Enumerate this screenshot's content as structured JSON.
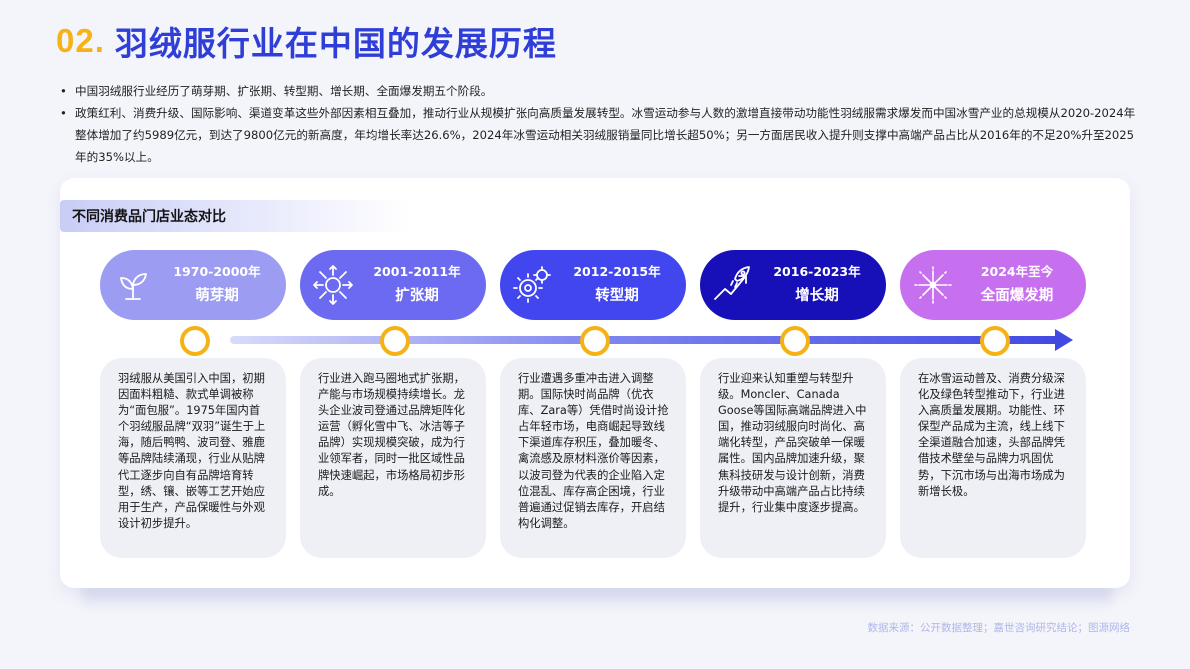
{
  "header": {
    "number": "02.",
    "title": "羽绒服行业在中国的发展历程"
  },
  "bullets": [
    "中国羽绒服行业经历了萌芽期、扩张期、转型期、增长期、全面爆发期五个阶段。",
    "政策红利、消费升级、国际影响、渠道变革这些外部因素相互叠加，推动行业从规模扩张向高质量发展转型。冰雪运动参与人数的激增直接带动功能性羽绒服需求爆发而中国冰雪产业的总规模从2020-2024年整体增加了约5989亿元，到达了9800亿元的新高度，年均增长率达26.6%，2024年冰雪运动相关羽绒服销量同比增长超50%；另一方面居民收入提升则支撑中高端产品占比从2016年的不足20%升至2025年的35%以上。"
  ],
  "card": {
    "subtitle": "不同消费品门店业态对比"
  },
  "timeline": [
    {
      "years": "1970-2000年",
      "stage": "萌芽期",
      "icon": "sprout-icon",
      "color": "#9c9cf2",
      "desc": "羽绒服从美国引入中国，初期因面料粗糙、款式单调被称为“面包服”。1975年国内首个羽绒服品牌“双羽”诞生于上海，随后鸭鸭、波司登、雅鹿等品牌陆续涌现，行业从贴牌代工逐步向自有品牌培育转型，绣、镶、嵌等工艺开始应用于生产，产品保暖性与外观设计初步提升。"
    },
    {
      "years": "2001-2011年",
      "stage": "扩张期",
      "icon": "expand-icon",
      "color": "#6b6af0",
      "desc": "行业进入跑马圈地式扩张期，产能与市场规模持续增长。龙头企业波司登通过品牌矩阵化运营（孵化雪中飞、冰洁等子品牌）实现规模突破，成为行业领军者，同时一批区域性品牌快速崛起，市场格局初步形成。"
    },
    {
      "years": "2012-2015年",
      "stage": "转型期",
      "icon": "gears-icon",
      "color": "#4146ef",
      "desc": "行业遭遇多重冲击进入调整期。国际快时尚品牌（优衣库、Zara等）凭借时尚设计抢占年轻市场，电商崛起导致线下渠道库存积压，叠加暖冬、禽流感及原材料涨价等因素，以波司登为代表的企业陷入定位混乱、库存高企困境，行业普遍通过促销去库存，开启结构化调整。"
    },
    {
      "years": "2016-2023年",
      "stage": "增长期",
      "icon": "rocket-growth-icon",
      "color": "#1710b8",
      "desc": "行业迎来认知重塑与转型升级。Moncler、Canada Goose等国际高端品牌进入中国，推动羽绒服向时尚化、高端化转型，产品突破单一保暖属性。国内品牌加速升级，聚焦科技研发与设计创新，消费升级带动中高端产品占比持续提升，行业集中度逐步提高。"
    },
    {
      "years": "2024年至今",
      "stage": "全面爆发期",
      "icon": "fireworks-icon",
      "color": "#c670ef",
      "desc": "在冰雪运动普及、消费分级深化及绿色转型推动下，行业进入高质量发展期。功能性、环保型产品成为主流，线上线下全渠道融合加速，头部品牌凭借技术壁垒与品牌力巩固优势，下沉市场与出海市场成为新增长极。"
    }
  ],
  "source": "数据来源：公开数据整理；嘉世咨询研究结论；图源网络"
}
